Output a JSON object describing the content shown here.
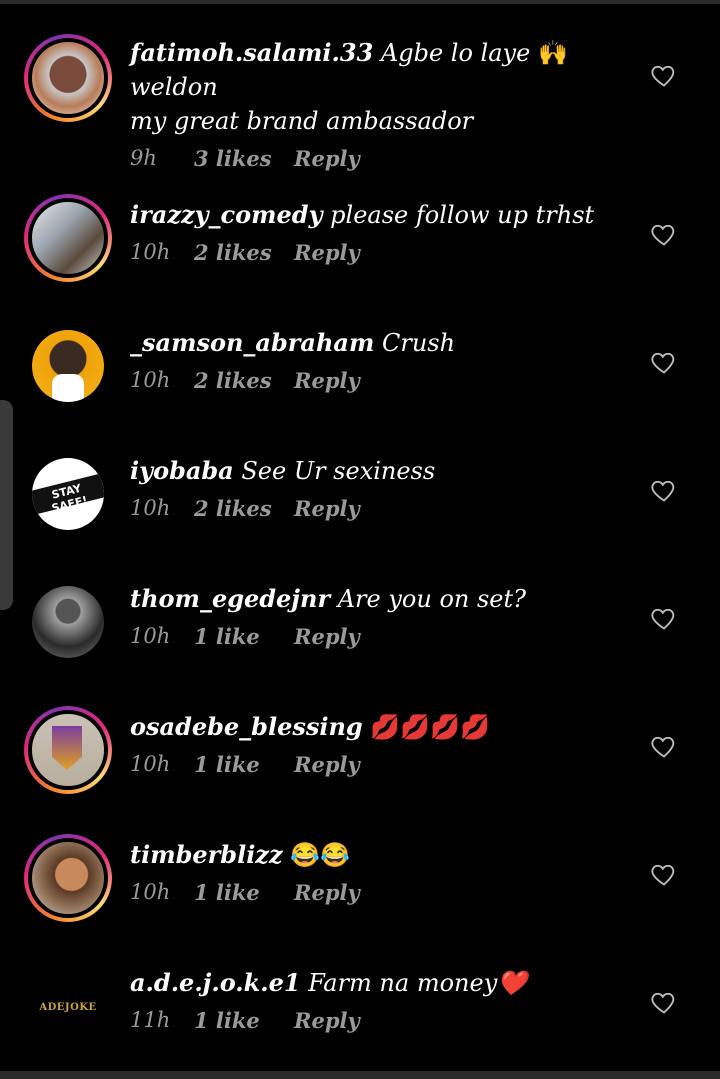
{
  "comments": [
    {
      "username": "fatimoh.salami.33",
      "text_line1": " Agbe lo laye ",
      "emoji1": "🙌",
      "text_line1b": "weldon",
      "text_line2": "my great brand ambassador",
      "time": "9h",
      "likes": "3 likes",
      "reply": "Reply"
    },
    {
      "username": "irazzy_comedy",
      "text": " please follow up trhst",
      "time": "10h",
      "likes": "2 likes",
      "reply": "Reply"
    },
    {
      "username": "_samson_abraham",
      "text": " Crush",
      "time": "10h",
      "likes": "2 likes",
      "reply": "Reply"
    },
    {
      "username": "iyobaba",
      "text": " See Ur sexiness",
      "time": "10h",
      "likes": "2 likes",
      "reply": "Reply",
      "avatar_text": "STAY SAFE!"
    },
    {
      "username": "thom_egedejnr",
      "text": " Are you on set?",
      "time": "10h",
      "likes": "1 like",
      "reply": "Reply"
    },
    {
      "username": "osadebe_blessing",
      "text": " 💋💋💋💋",
      "time": "10h",
      "likes": "1 like",
      "reply": "Reply"
    },
    {
      "username": "timberblizz",
      "text": " 😂😂",
      "time": "10h",
      "likes": "1 like",
      "reply": "Reply"
    },
    {
      "username": "a.d.e.j.o.k.e1",
      "text": " Farm na money❤️",
      "time": "11h",
      "likes": "1 like",
      "reply": "Reply",
      "avatar_text": "ADEJOKE"
    }
  ],
  "colors": {
    "background": "#000000",
    "meta": "#9a9a9a",
    "ring_start": "#f58529",
    "ring_end": "#dd2a7b"
  },
  "icons": {
    "like": "heart-outline-icon"
  }
}
